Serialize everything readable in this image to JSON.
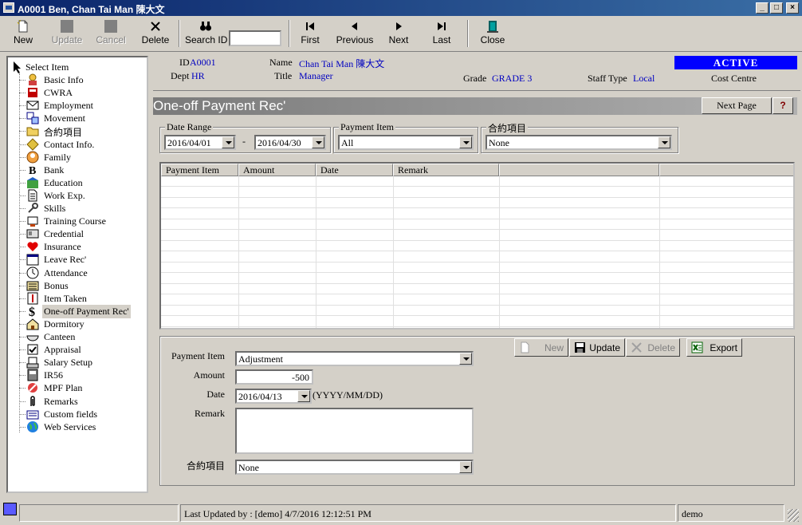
{
  "window": {
    "title": "A0001 Ben, Chan Tai Man 陳大文"
  },
  "toolbar": {
    "new": "New",
    "update": "Update",
    "cancel": "Cancel",
    "delete": "Delete",
    "search_id": "Search ID",
    "search_value": "",
    "first": "First",
    "previous": "Previous",
    "next": "Next",
    "last": "Last",
    "close": "Close"
  },
  "sidebar": {
    "root": "Select Item",
    "items": [
      {
        "label": "Basic Info",
        "icon": "person-icon"
      },
      {
        "label": "CWRA",
        "icon": "book-icon"
      },
      {
        "label": "Employment",
        "icon": "envelope-icon"
      },
      {
        "label": "Movement",
        "icon": "movement-icon"
      },
      {
        "label": "合約項目",
        "icon": "folder-icon"
      },
      {
        "label": "Contact Info.",
        "icon": "contact-icon"
      },
      {
        "label": "Family",
        "icon": "family-icon"
      },
      {
        "label": "Bank",
        "icon": "bold-b-icon"
      },
      {
        "label": "Education",
        "icon": "education-icon"
      },
      {
        "label": "Work Exp.",
        "icon": "document-icon"
      },
      {
        "label": "Skills",
        "icon": "wrench-icon"
      },
      {
        "label": "Training Course",
        "icon": "training-icon"
      },
      {
        "label": "Credential",
        "icon": "card-icon"
      },
      {
        "label": "Insurance",
        "icon": "heart-icon"
      },
      {
        "label": "Leave Rec'",
        "icon": "calendar-icon"
      },
      {
        "label": "Attendance",
        "icon": "clock-icon"
      },
      {
        "label": "Bonus",
        "icon": "bonus-icon"
      },
      {
        "label": "Item Taken",
        "icon": "item-taken-icon"
      },
      {
        "label": "One-off Payment Rec'",
        "icon": "dollar-icon"
      },
      {
        "label": "Dormitory",
        "icon": "house-icon"
      },
      {
        "label": "Canteen",
        "icon": "bowl-icon"
      },
      {
        "label": "Appraisal",
        "icon": "checkbox-icon"
      },
      {
        "label": "Salary Setup",
        "icon": "salary-icon"
      },
      {
        "label": "IR56",
        "icon": "ir56-icon"
      },
      {
        "label": "MPF Plan",
        "icon": "mpf-icon"
      },
      {
        "label": "Remarks",
        "icon": "paperclip-icon"
      },
      {
        "label": "Custom fields",
        "icon": "custom-fields-icon"
      },
      {
        "label": "Web Services",
        "icon": "globe-icon"
      }
    ]
  },
  "info": {
    "id_label": "ID",
    "id_value": "A0001",
    "dept_label": "Dept",
    "dept_value": "HR",
    "name_label": "Name",
    "name_value": "Chan Tai Man 陳大文",
    "title_label": "Title",
    "title_value": "Manager",
    "grade_label": "Grade",
    "grade_value": "GRADE 3",
    "staff_type_label": "Staff Type",
    "staff_type_value": "Local",
    "status": "ACTIVE",
    "cost_centre_label": "Cost Centre"
  },
  "section": {
    "title": "One-off Payment Rec'",
    "next_page": "Next Page",
    "help": "?"
  },
  "filters": {
    "date_range_label": "Date Range",
    "date_from": "2016/04/01",
    "date_sep": "-",
    "date_to": "2016/04/30",
    "payment_item_label": "Payment Item",
    "payment_item_value": "All",
    "contract_label": "合約項目",
    "contract_value": "None"
  },
  "grid": {
    "columns": [
      "Payment Item",
      "Amount",
      "Date",
      "Remark",
      "",
      ""
    ]
  },
  "detail": {
    "payment_item_label": "Payment Item",
    "payment_item_value": "Adjustment",
    "amount_label": "Amount",
    "amount_value": "-500",
    "date_label": "Date",
    "date_value": "2016/04/13",
    "date_hint": "(YYYY/MM/DD)",
    "remark_label": "Remark",
    "remark_value": "",
    "contract_label": "合約項目",
    "contract_value": "None"
  },
  "actions": {
    "new": "New",
    "update": "Update",
    "delete": "Delete",
    "export": "Export"
  },
  "status": {
    "last_updated": "Last Updated by : [demo]  4/7/2016 12:12:51 PM",
    "user": "demo"
  },
  "colors": {
    "accent": "#0000ff",
    "value_text": "#0000c0",
    "title_bar": "#0a246a"
  }
}
